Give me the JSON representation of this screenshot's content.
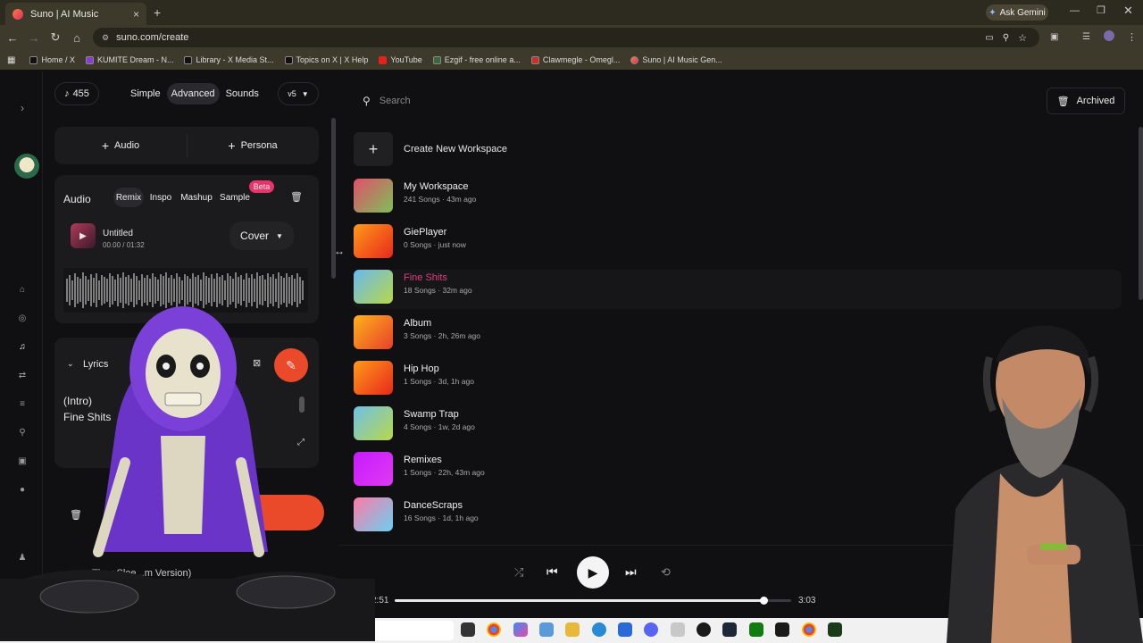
{
  "browser": {
    "tab_title": "Suno | AI Music",
    "tab_close": "×",
    "new_tab": "+",
    "ask_gemini": "Ask Gemini",
    "url": "suno.com/create",
    "bookmarks": [
      "Home / X",
      "KUMITE Dream - N...",
      "Library - X Media St...",
      "Topics on X | X Help",
      "YouTube",
      "Ezgif - free online a...",
      "Clawmegle - Omegl...",
      "Suno | AI Music Gen..."
    ]
  },
  "left": {
    "credits": "455",
    "modes": [
      "Simple",
      "Advanced",
      "Sounds"
    ],
    "version": "v5",
    "add_audio": "Audio",
    "add_persona": "Persona",
    "audio_label": "Audio",
    "audio_tabs": [
      "Remix",
      "Inspo",
      "Mashup",
      "Sample"
    ],
    "beta_badge": "Beta",
    "track_title": "Untitled",
    "track_time": "00.00 / 01:32",
    "cover_label": "Cover",
    "lyrics_label": "Lyrics",
    "lyrics_lines": [
      "(Intro)",
      "Fine Shits"
    ],
    "bottom_text": "They Slee...m Version)"
  },
  "right": {
    "search_placeholder": "Search",
    "archived_label": "Archived",
    "create_label": "Create New Workspace",
    "workspaces": [
      {
        "name": "My Workspace",
        "meta": "241 Songs · 43m ago",
        "colors": [
          "#e0506a",
          "#7fbf5a"
        ],
        "active": false
      },
      {
        "name": "GiePlayer",
        "meta": "0 Songs · just now",
        "colors": [
          "#ff9a1a",
          "#e8281a"
        ],
        "active": false
      },
      {
        "name": "Fine Shits",
        "meta": "18 Songs · 32m ago",
        "colors": [
          "#6ab8f0",
          "#b6d84a"
        ],
        "active": true
      },
      {
        "name": "Album",
        "meta": "3 Songs · 2h, 26m ago",
        "colors": [
          "#ffb21a",
          "#e8402a"
        ],
        "active": false
      },
      {
        "name": "Hip Hop",
        "meta": "1 Songs · 3d, 1h ago",
        "colors": [
          "#ff9a1a",
          "#e8281a"
        ],
        "active": false
      },
      {
        "name": "Swamp Trap",
        "meta": "4 Songs · 1w, 2d ago",
        "colors": [
          "#6fc0e8",
          "#b8d84a"
        ],
        "active": false
      },
      {
        "name": "Remixes",
        "meta": "1 Songs · 22h, 43m ago",
        "colors": [
          "#c81aff",
          "#e03af0"
        ],
        "active": false
      },
      {
        "name": "DanceScraps",
        "meta": "16 Songs · 1d, 1h ago",
        "colors": [
          "#ff7aa8",
          "#6ad0f0"
        ],
        "active": false
      }
    ]
  },
  "player": {
    "elapsed": "2:51",
    "total": "3:03",
    "progress": 0.93
  },
  "colors": {
    "accent": "#ea4a2a",
    "active_name": "#e0407a",
    "beta": "#e8336b"
  }
}
